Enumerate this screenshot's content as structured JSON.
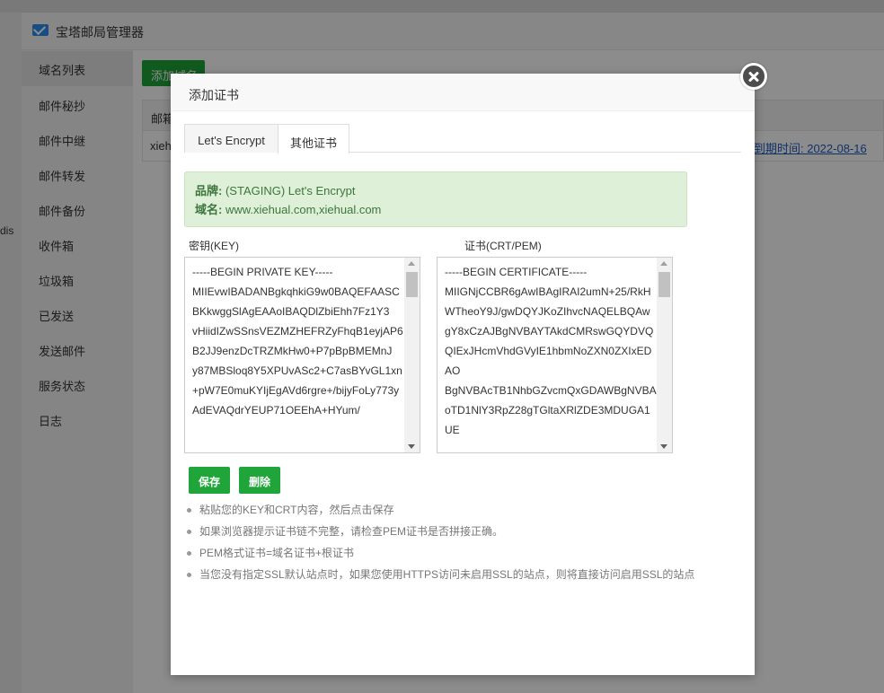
{
  "app": {
    "title": "宝塔邮局管理器",
    "sidebar": [
      "域名列表",
      "邮件秘抄",
      "邮件中继",
      "邮件转发",
      "邮件备份",
      "收件箱",
      "垃圾箱",
      "已发送",
      "发送邮件",
      "服务状态",
      "日志"
    ],
    "add_domain_button": "添加域名",
    "table_header_first": "邮箱",
    "row_first": "xieh",
    "row_expiry": "到期时间: 2022-08-16",
    "left_fragment": "dis"
  },
  "modal": {
    "title": "添加证书",
    "tabs": [
      "Let's Encrypt",
      "其他证书"
    ],
    "active_tab": 1,
    "info": {
      "brand_label": "品牌:",
      "brand_value": "(STAGING) Let's Encrypt",
      "domain_label": "域名:",
      "domain_value": "www.xiehual.com,xiehual.com"
    },
    "key_label": "密钥(KEY)",
    "cert_label": "证书(CRT/PEM)",
    "key_text": "-----BEGIN PRIVATE KEY-----\nMIIEvwIBADANBgkqhkiG9w0BAQEFAASCBKkwggSlAgEAAoIBAQDlZbiEhh7Fz1Y3\nvHiidIZwSSnsVEZMZHEFRZyFhqB1eyjAP6B2JJ9enzDcTRZMkHw0+P7pBpBMEMnJ\ny87MBSloq8Y5XPUvASc2+C7asBYvGL1xn+pW7E0muKYIjEgAVd6rgre+/bijyFoLy773yAdEVAQdrYEUP71OEEhA+HYum/",
    "cert_text": "-----BEGIN CERTIFICATE-----\nMIIGNjCCBR6gAwIBAgIRAI2umN+25/RkHWTheoY9J/gwDQYJKoZIhvcNAQELBQAw\ngY8xCzAJBgNVBAYTAkdCMRswGQYDVQQIExJHcmVhdGVyIE1hbmNoZXN0ZXIxEDAO\nBgNVBAcTB1NhbGZvcmQxGDAWBgNVBAoTD1NlY3RpZ28gTGltaXRlZDE3MDUGA1UE",
    "save_button": "保存",
    "delete_button": "删除",
    "tips": [
      "粘贴您的KEY和CRT内容，然后点击保存",
      "如果浏览器提示证书链不完整，请检查PEM证书是否拼接正确。",
      "PEM格式证书=域名证书+根证书",
      "当您没有指定SSL默认站点时，如果您使用HTTPS访问未启用SSL的站点，则将直接访问启用SSL的站点"
    ]
  },
  "colors": {
    "accent_green": "#20a53a",
    "info_bg": "#dff0d8",
    "info_text": "#3c763d"
  }
}
